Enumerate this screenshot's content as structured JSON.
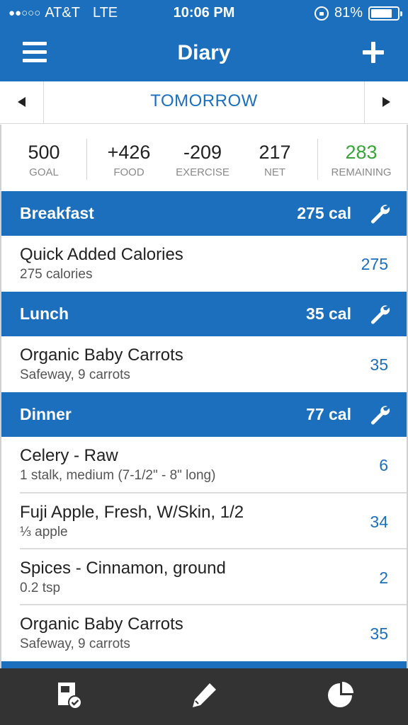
{
  "status_bar": {
    "signal_dots": "●●○○○",
    "carrier": "AT&T",
    "network": "LTE",
    "time": "10:06 PM",
    "battery": "81%",
    "battery_level": 0.81
  },
  "nav": {
    "title": "Diary",
    "menu_icon": "hamburger-menu-icon",
    "add_icon": "plus-icon"
  },
  "date_bar": {
    "label": "TOMORROW",
    "prev_icon": "triangle-left-icon",
    "next_icon": "triangle-right-icon"
  },
  "summary": {
    "goal": {
      "value": "500",
      "label": "GOAL"
    },
    "food": {
      "value": "+426",
      "label": "FOOD"
    },
    "exercise": {
      "value": "-209",
      "label": "EXERCISE"
    },
    "net": {
      "value": "217",
      "label": "NET"
    },
    "remaining": {
      "value": "283",
      "label": "REMAINING"
    }
  },
  "meals": [
    {
      "name": "Breakfast",
      "calories": "275 cal",
      "items": [
        {
          "title": "Quick Added Calories",
          "subtitle": "275 calories",
          "calories": "275"
        }
      ]
    },
    {
      "name": "Lunch",
      "calories": "35 cal",
      "items": [
        {
          "title": "Organic Baby Carrots",
          "subtitle": "Safeway, 9 carrots",
          "calories": "35"
        }
      ]
    },
    {
      "name": "Dinner",
      "calories": "77 cal",
      "items": [
        {
          "title": "Celery - Raw",
          "subtitle": "1 stalk, medium (7-1/2\" - 8\" long)",
          "calories": "6"
        },
        {
          "title": "Fuji Apple, Fresh, W/Skin, 1/2",
          "subtitle": "⅓ apple",
          "calories": "34"
        },
        {
          "title": "Spices - Cinnamon, ground",
          "subtitle": "0.2 tsp",
          "calories": "2"
        },
        {
          "title": "Organic Baby Carrots",
          "subtitle": "Safeway, 9 carrots",
          "calories": "35"
        }
      ]
    }
  ],
  "tab_bar": {
    "tabs": [
      {
        "icon": "diary-check-icon"
      },
      {
        "icon": "pencil-icon"
      },
      {
        "icon": "pie-chart-icon"
      }
    ]
  },
  "colors": {
    "brand_blue": "#1b6fbd",
    "remaining_green": "#3aa43a",
    "tab_bar_bg": "#333333"
  }
}
